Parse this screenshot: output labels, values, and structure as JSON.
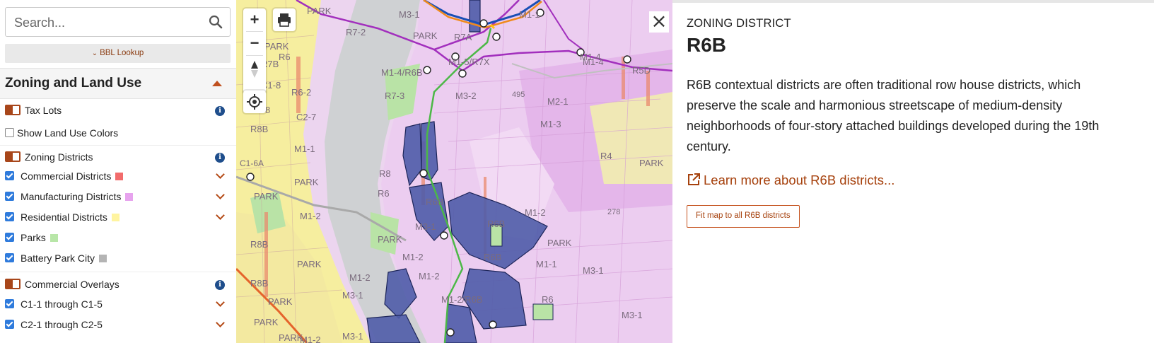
{
  "sidebar": {
    "search": {
      "placeholder": "Search...",
      "value": ""
    },
    "bbl_lookup": "BBL Lookup",
    "section_title": "Zoning and Land Use",
    "layers": [
      {
        "label": "Tax Lots",
        "kind": "toggle",
        "info": true
      },
      {
        "label": "Show Land Use Colors",
        "kind": "checkbox",
        "checked": false
      },
      {
        "label": "Zoning Districts",
        "kind": "toggle",
        "info": true
      },
      {
        "label": "Commercial Districts",
        "kind": "checkbox",
        "checked": true,
        "color": "#f26c6c",
        "expandable": true
      },
      {
        "label": "Manufacturing Districts",
        "kind": "checkbox",
        "checked": true,
        "color": "#e7a3ee",
        "expandable": true
      },
      {
        "label": "Residential Districts",
        "kind": "checkbox",
        "checked": true,
        "color": "#fff4a0",
        "expandable": true
      },
      {
        "label": "Parks",
        "kind": "checkbox",
        "checked": true,
        "color": "#b8e6a8"
      },
      {
        "label": "Battery Park City",
        "kind": "checkbox",
        "checked": true,
        "color": "#b4b4b4"
      },
      {
        "label": "Commercial Overlays",
        "kind": "toggle",
        "info": true
      },
      {
        "label": "C1-1 through C1-5",
        "kind": "checkbox",
        "checked": true,
        "expandable": true
      },
      {
        "label": "C2-1 through C2-5",
        "kind": "checkbox",
        "checked": true,
        "expandable": true
      }
    ]
  },
  "map": {
    "labels": [
      "PARK",
      "PARK",
      "M3-1",
      "M1-1",
      "R7-2",
      "R7A",
      "M1-5/R7X",
      "M1-4/R6B",
      "R7-3",
      "M3-2",
      "495",
      "M2-1",
      "M1-3",
      "R4",
      "PARK",
      "M1-4",
      "R5D",
      "C1-8",
      "R6",
      "R8B",
      "C2-7",
      "M1-1",
      "M1-2",
      "PARK",
      "R6",
      "R8",
      "C1-6A",
      "PARK",
      "R6B",
      "M3-1",
      "PARK",
      "M1-2",
      "PARK",
      "R8B",
      "R8B",
      "PARK",
      "M3-1",
      "M1-2",
      "M1-2/R6B",
      "R6",
      "M1-1",
      "M3-1",
      "M3-1",
      "PARK",
      "278",
      "M1-2",
      "R6B",
      "R6B",
      "PARK",
      "M3-1",
      "PARK",
      "M1-4",
      "M1-2",
      "R7B",
      "R6-2",
      "PARK",
      "C1-8",
      "M1-2"
    ],
    "zoom_in": "+",
    "zoom_out": "−",
    "icons": [
      "print-icon",
      "compass-icon",
      "locate-icon"
    ]
  },
  "panel": {
    "kicker": "ZONING DISTRICT",
    "title": "R6B",
    "description": "R6B contextual districts are often traditional row house districts, which preserve the scale and harmonious streetscape of medium-density neighborhoods of four-story attached buildings developed during the 19th century.",
    "learn_more": "Learn more about R6B districts...",
    "fit_button": "Fit map to all R6B districts",
    "close": "×"
  },
  "colors": {
    "accent": "#a6410d",
    "checkbox": "#2f7bdc",
    "info": "#1f4e8c",
    "toggle": "#a8461a"
  }
}
